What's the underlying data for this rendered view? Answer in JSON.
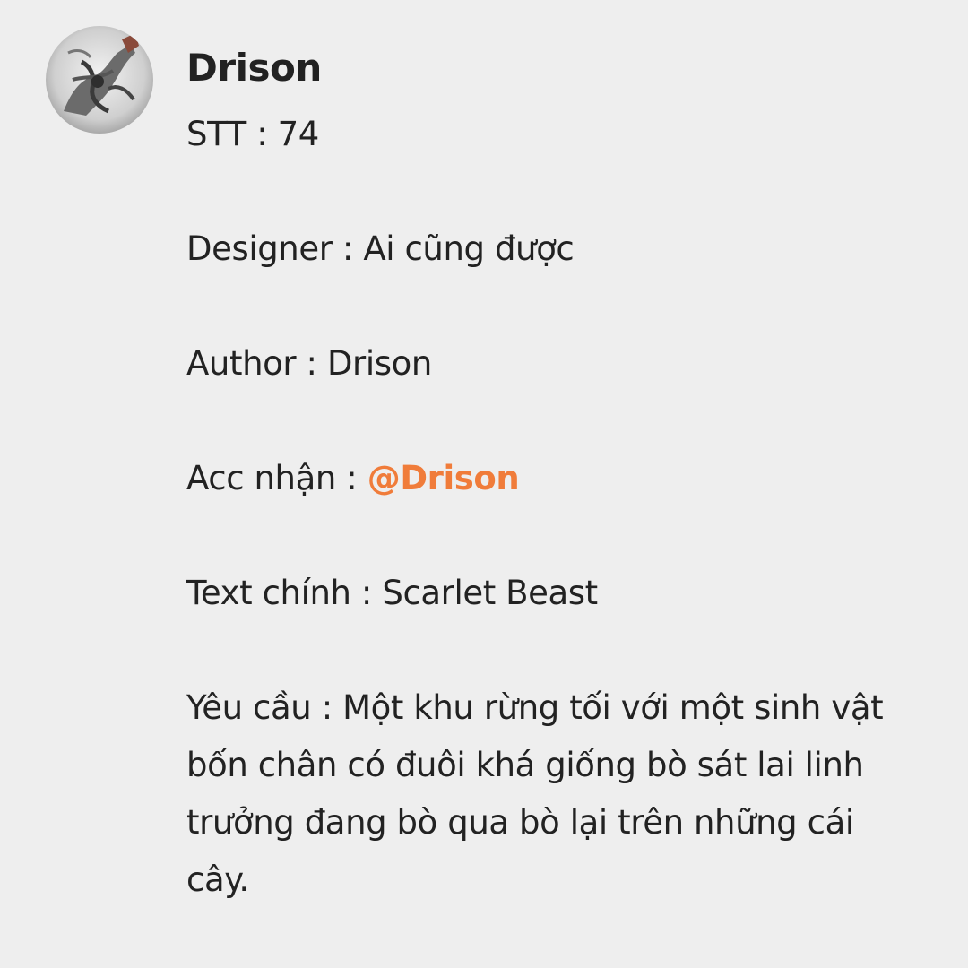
{
  "post": {
    "author_name": "Drison",
    "avatar_icon": "profile-artwork-icon",
    "fields": {
      "stt_label": "STT : ",
      "stt_value": "74",
      "designer_label": "Designer : ",
      "designer_value": "Ai cũng được",
      "author_label": "Author : ",
      "author_value": "Drison",
      "acc_label": "Acc nhận : ",
      "acc_mention": "@Drison",
      "text_label": "Text chính : ",
      "text_value": "Scarlet Beast",
      "request_label": "Yêu cầu : ",
      "request_value": "Một khu rừng tối với một sinh vật bốn chân có đuôi khá giống bò sát lai linh trưởng đang bò qua bò lại trên những cái cây."
    }
  },
  "colors": {
    "background": "#eeeeee",
    "text": "#222222",
    "mention": "#f07c3a"
  }
}
